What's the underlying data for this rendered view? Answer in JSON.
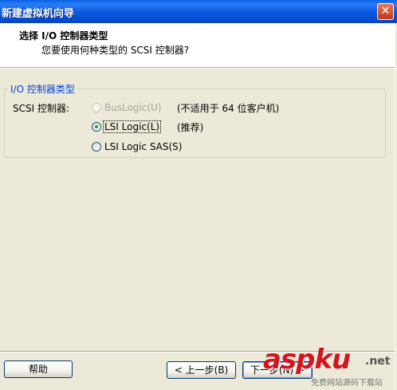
{
  "window": {
    "title": "新建虚拟机向导",
    "close_glyph": "✕"
  },
  "header": {
    "title": "选择 I/O 控制器类型",
    "subtitle": "您要使用何种类型的 SCSI 控制器?"
  },
  "group": {
    "legend": "I/O 控制器类型",
    "field_label": "SCSI 控制器:",
    "options": [
      {
        "label": "BusLogic(U)",
        "note": "(不适用于 64 位客户机)",
        "checked": false,
        "disabled": true
      },
      {
        "label": "LSI Logic(L)",
        "note": "(推荐)",
        "checked": true,
        "disabled": false
      },
      {
        "label": "LSI Logic SAS(S)",
        "note": "",
        "checked": false,
        "disabled": false
      }
    ]
  },
  "footer": {
    "help_label": "帮助",
    "back_label": "< 上一步(B)",
    "next_label": "下一步(N) >"
  },
  "watermark": {
    "brand": "aspku",
    "tld": ".net",
    "tagline": "免费网站源码下载站"
  },
  "colors": {
    "titlebar": "#0858e0",
    "legend": "#0046d5",
    "window_bg": "#ece9d8",
    "radio_dot": "#21a121",
    "watermark": "#d3151c"
  }
}
